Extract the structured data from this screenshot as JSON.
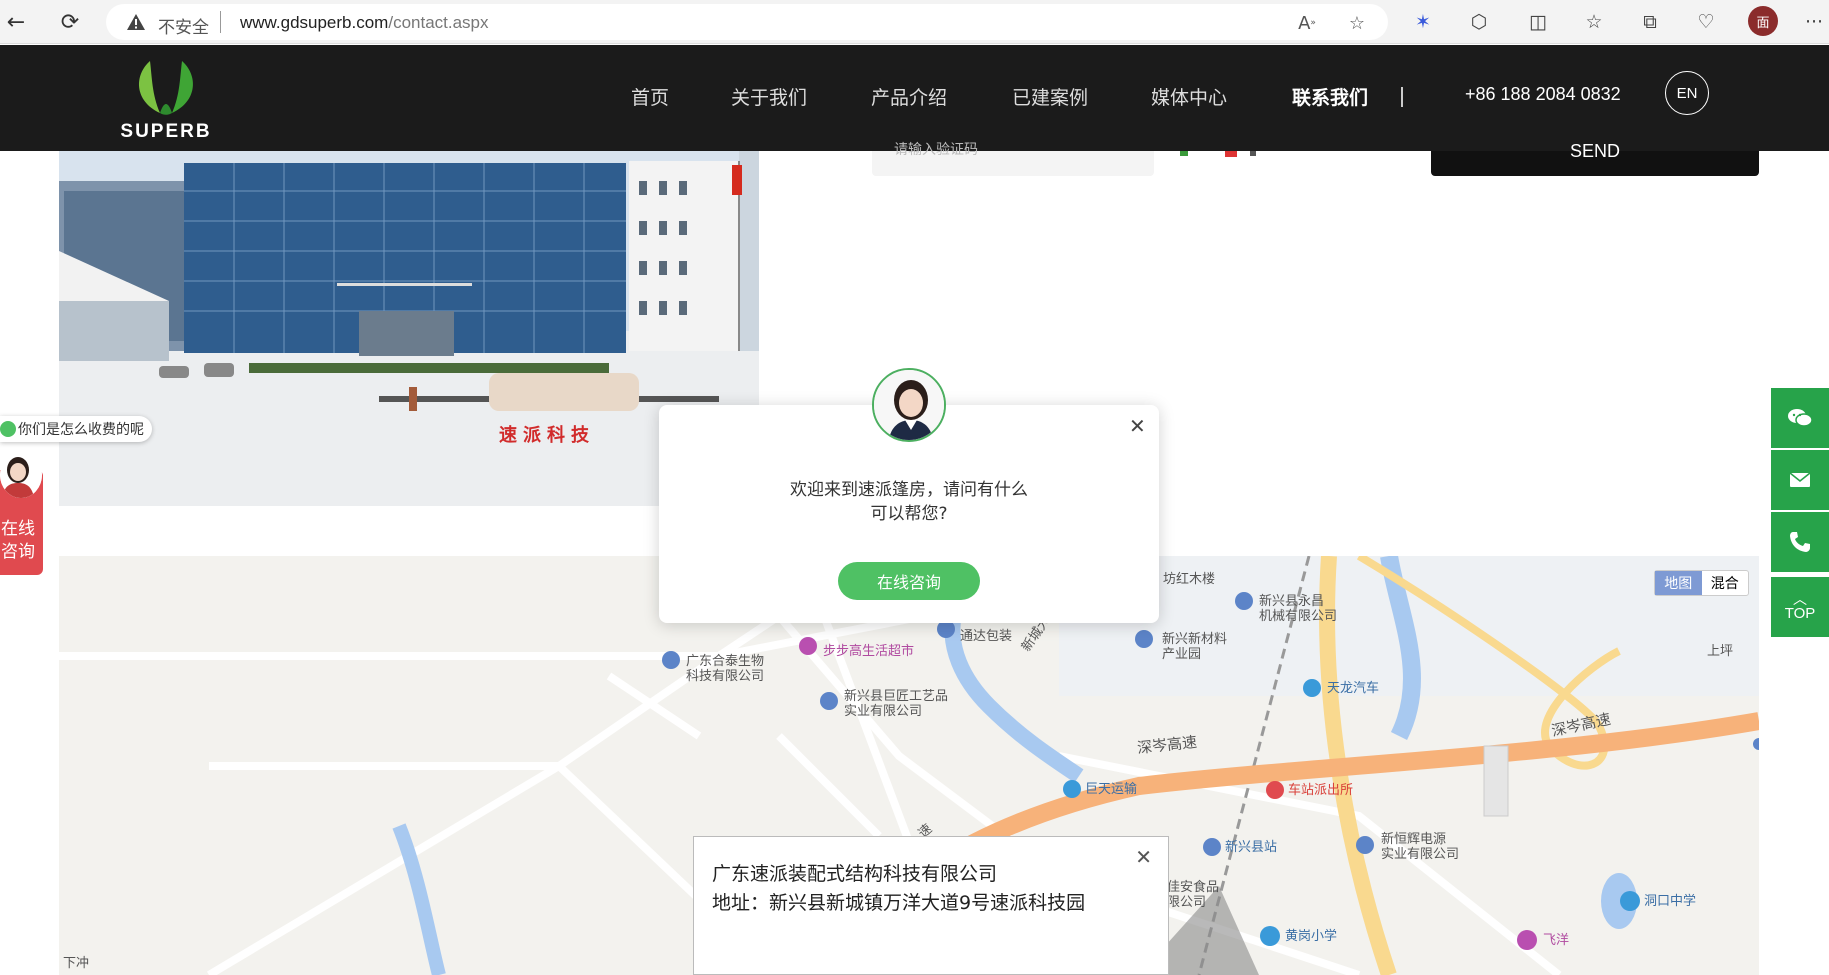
{
  "browser": {
    "security_label": "不安全",
    "url_host": "www.gdsuperb.com",
    "url_path": "/contact.aspx"
  },
  "site": {
    "logo_text": "SUPERB",
    "brand_color": "#4caf50",
    "nav": [
      "首页",
      "关于我们",
      "产品介绍",
      "已建案例",
      "媒体中心",
      "联系我们"
    ],
    "active_nav": "联系我们",
    "phone": "+86 188 2084 0832",
    "lang_button": "EN"
  },
  "form": {
    "captcha_placeholder": "请输入验证码",
    "send_label": "SEND"
  },
  "photo": {
    "sign_text": "速派科技"
  },
  "chat_popup": {
    "message_line1": "欢迎来到速派篷房，请问有什么",
    "message_line2": "可以帮您?",
    "button_label": "在线咨询",
    "close_icon": "close-icon"
  },
  "left_widgets": {
    "question": "你们是怎么收费的呢",
    "consult_line1": "在线",
    "consult_line2": "咨询"
  },
  "right_toolbar": {
    "items": [
      "wechat-icon",
      "mail-icon",
      "phone-icon"
    ],
    "top_label": "TOP",
    "color": "#27a34a"
  },
  "map": {
    "type_options": [
      "地图",
      "混合"
    ],
    "selected_type": "地图",
    "labels": {
      "l1": "坊红木楼",
      "l2": "新兴县永昌",
      "l3": "机械有限公司",
      "l4": "通达包装",
      "l5": "新兴新材料",
      "l6": "产业园",
      "l7": "广东合泰生物",
      "l8": "科技有限公司",
      "l9": "步步高生活超市",
      "l10": "新兴县巨匠工艺品",
      "l11": "实业有限公司",
      "l12": "新城大道",
      "l13": "天龙汽车",
      "l14": "上坪",
      "l15": "深岑高速",
      "l16": "深岑高速",
      "l17": "巨天运输",
      "l18": "车站派出所",
      "l19": "新兴县站",
      "l20": "新恒辉电源",
      "l21": "实业有限公司",
      "l22": "佳安食品",
      "l23": "限公司",
      "l24": "洞口中学",
      "l25": "黄岗小学",
      "l26": "飞洋",
      "l27": "下冲",
      "l28": "速"
    },
    "info_title": "广东速派装配式结构科技有限公司",
    "info_address": "地址：新兴县新城镇万洋大道9号速派科技园"
  }
}
